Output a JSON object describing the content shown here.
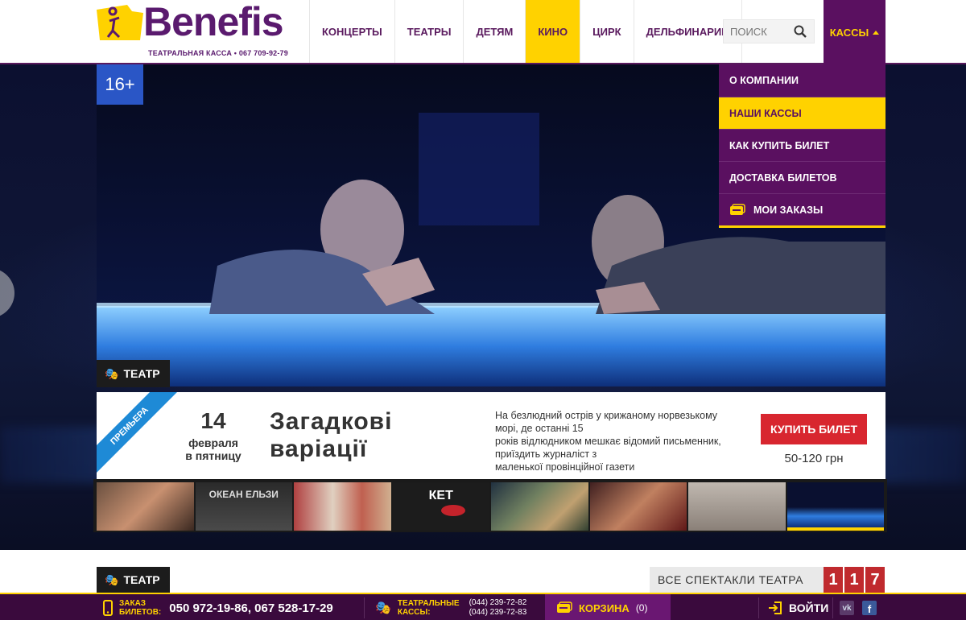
{
  "header": {
    "logo_text": "Benefis",
    "logo_sub": "ТЕАТРАЛЬНАЯ КАССА • 067 709-92-79",
    "nav": [
      {
        "label": "КОНЦЕРТЫ",
        "active": false
      },
      {
        "label": "ТЕАТРЫ",
        "active": false
      },
      {
        "label": "ДЕТЯМ",
        "active": false
      },
      {
        "label": "КИНО",
        "active": true
      },
      {
        "label": "ЦИРК",
        "active": false
      },
      {
        "label": "ДЕЛЬФИНАРИЙ",
        "active": false
      }
    ],
    "search_placeholder": "ПОИСК",
    "kassy_label": "КАССЫ"
  },
  "dropdown": {
    "items": [
      {
        "label": "О КОМПАНИИ",
        "active": false
      },
      {
        "label": "НАШИ КАССЫ",
        "active": true
      },
      {
        "label": "КАК КУПИТЬ БИЛЕТ",
        "active": false
      },
      {
        "label": "ДОСТАВКА БИЛЕТОВ",
        "active": false
      },
      {
        "label": "МОИ ЗАКАЗЫ",
        "active": false
      }
    ]
  },
  "hero": {
    "rating": "16+",
    "genre": "ТЕАТР",
    "ribbon": "ПРЕМЬЕРА",
    "date_day": "14",
    "date_month": "февраля",
    "date_weekday": "в пятницу",
    "title_line1": "Загадкові",
    "title_line2": "варіації",
    "description": [
      "На безлюдний острів у крижаному норвезькому",
      "морі, де останні 15",
      "років відлюдником мешкає відомий письменник,",
      "приїздить журналіст з",
      "маленької провінційної газети"
    ],
    "buy_label": "КУПИТЬ БИЛЕТ",
    "price": "50-120 грн",
    "thumbs": [
      {
        "label": ""
      },
      {
        "label": "ОКЕАН ЕЛЬЗИ"
      },
      {
        "label": ""
      },
      {
        "label": "КЕТ"
      },
      {
        "label": ""
      },
      {
        "label": ""
      },
      {
        "label": ""
      },
      {
        "label": ""
      }
    ]
  },
  "section": {
    "genre": "ТЕАТР",
    "all_shows": "ВСЕ СПЕКТАКЛИ ТЕАТРА",
    "count_digits": [
      "1",
      "1",
      "7"
    ]
  },
  "footer": {
    "order_label_1": "ЗАКАЗ",
    "order_label_2": "БИЛЕТОВ:",
    "order_phones": "050 972-19-86, 067 528-17-29",
    "kassy_label_1": "ТЕАТРАЛЬНЫЕ",
    "kassy_label_2": "КАССЫ:",
    "kassy_phone_1": "(044) 239-72-82",
    "kassy_phone_2": "(044) 239-72-83",
    "cart_label": "КОРЗИНА",
    "cart_count": "(0)",
    "login_label": "ВОЙТИ"
  },
  "colors": {
    "brand_purple": "#5a1060",
    "brand_yellow": "#ffd200",
    "buy_red": "#d8262f",
    "rating_blue": "#2a56c6",
    "ribbon_blue": "#1e8ad6"
  }
}
